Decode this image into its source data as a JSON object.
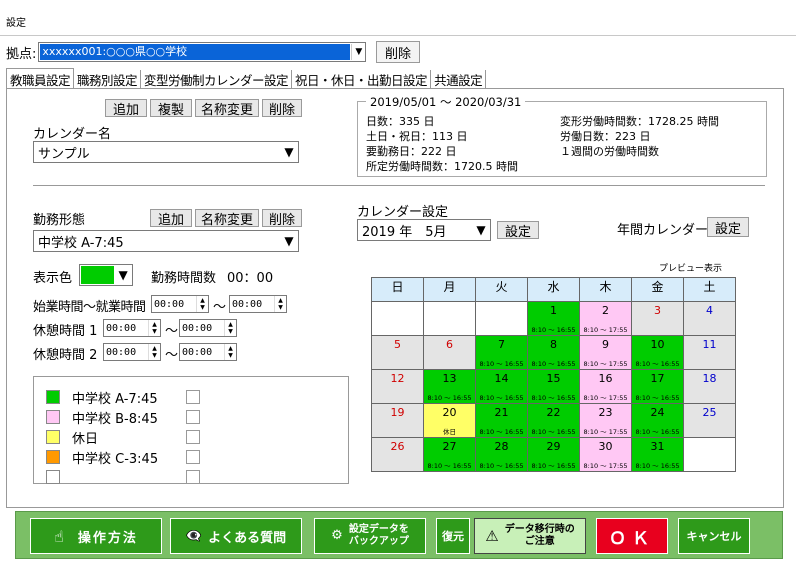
{
  "window_title": "設定",
  "site": {
    "label": "拠点:",
    "value": "xxxxxx001:○○○県○○学校",
    "delete_label": "削除"
  },
  "tabs": [
    "教職員設定",
    "職務別設定",
    "変型労働制カレンダー設定",
    "祝日・休日・出勤日設定",
    "共通設定"
  ],
  "calendar_name": {
    "buttons": [
      "追加",
      "複製",
      "名称変更",
      "削除"
    ],
    "label": "カレンダー名",
    "value": "サンプル"
  },
  "summary": {
    "period": "2019/05/01 ～ 2020/03/31",
    "days": "日数：335 日",
    "holidays": "土日・祝日：113 日",
    "required": "要勤務日：222 日",
    "scheduled": "所定労働時間数：1720.5 時間",
    "variable": "変形労働時間数：1728.25 時間",
    "workdays": "労働日数：223 日",
    "weekly": "１週間の労働時間数"
  },
  "work_type": {
    "label": "勤務形態",
    "buttons": [
      "追加",
      "名称変更",
      "削除"
    ],
    "value": "中学校 A-7:45",
    "color_label": "表示色",
    "color": "#00cc00",
    "hours_label": "勤務時間数",
    "hours": "00：00",
    "time_label": "始業時間～就業時間",
    "start": "00:00",
    "end": "00:00",
    "break1_label": "休憩時間 1",
    "b1s": "00:00",
    "b1e": "00:00",
    "break2_label": "休憩時間 2",
    "b2s": "00:00",
    "b2e": "00:00",
    "tilde": "～"
  },
  "legend": [
    {
      "name": "中学校 A-7:45",
      "color": "#00cc00"
    },
    {
      "name": "中学校 B-8:45",
      "color": "#ffc8f4"
    },
    {
      "name": "休日",
      "color": "#ffff66"
    },
    {
      "name": "中学校 C-3:45",
      "color": "#ff9900"
    },
    {
      "name": "",
      "color": "#ffffff"
    }
  ],
  "cal_setting": {
    "label": "カレンダー設定",
    "month": "2019 年　5月",
    "set": "設定",
    "annual_label": "年間カレンダー",
    "annual_set": "設定",
    "preview": "プレビュー表示"
  },
  "weekdays": [
    "日",
    "月",
    "火",
    "水",
    "木",
    "金",
    "土"
  ],
  "weeks": [
    [
      {
        "d": "",
        "c": "w"
      },
      {
        "d": "",
        "c": "w"
      },
      {
        "d": "",
        "c": "w"
      },
      {
        "d": "1",
        "c": "g",
        "t": "8:10 ～ 16:55"
      },
      {
        "d": "2",
        "c": "p",
        "t": "8:10 ～ 17:55"
      },
      {
        "d": "3",
        "c": "e"
      },
      {
        "d": "4",
        "c": "e"
      }
    ],
    [
      {
        "d": "5",
        "c": "e"
      },
      {
        "d": "6",
        "c": "e"
      },
      {
        "d": "7",
        "c": "g",
        "t": "8:10 ～ 16:55"
      },
      {
        "d": "8",
        "c": "g",
        "t": "8:10 ～ 16:55"
      },
      {
        "d": "9",
        "c": "p",
        "t": "8:10 ～ 17:55"
      },
      {
        "d": "10",
        "c": "g",
        "t": "8:10 ～ 16:55"
      },
      {
        "d": "11",
        "c": "e"
      }
    ],
    [
      {
        "d": "12",
        "c": "e"
      },
      {
        "d": "13",
        "c": "g",
        "t": "8:10 ～ 16:55"
      },
      {
        "d": "14",
        "c": "g",
        "t": "8:10 ～ 16:55"
      },
      {
        "d": "15",
        "c": "g",
        "t": "8:10 ～ 16:55"
      },
      {
        "d": "16",
        "c": "p",
        "t": "8:10 ～ 17:55"
      },
      {
        "d": "17",
        "c": "g",
        "t": "8:10 ～ 16:55"
      },
      {
        "d": "18",
        "c": "e"
      }
    ],
    [
      {
        "d": "19",
        "c": "e"
      },
      {
        "d": "20",
        "c": "y",
        "t": "休日"
      },
      {
        "d": "21",
        "c": "g",
        "t": "8:10 ～ 16:55"
      },
      {
        "d": "22",
        "c": "g",
        "t": "8:10 ～ 16:55"
      },
      {
        "d": "23",
        "c": "p",
        "t": "8:10 ～ 17:55"
      },
      {
        "d": "24",
        "c": "g",
        "t": "8:10 ～ 16:55"
      },
      {
        "d": "25",
        "c": "e"
      }
    ],
    [
      {
        "d": "26",
        "c": "e"
      },
      {
        "d": "27",
        "c": "g",
        "t": "8:10 ～ 16:55"
      },
      {
        "d": "28",
        "c": "g",
        "t": "8:10 ～ 16:55"
      },
      {
        "d": "29",
        "c": "g",
        "t": "8:10 ～ 16:55"
      },
      {
        "d": "30",
        "c": "p",
        "t": "8:10 ～ 17:55"
      },
      {
        "d": "31",
        "c": "g",
        "t": "8:10 ～ 16:55"
      },
      {
        "d": "",
        "c": "w"
      }
    ]
  ],
  "bottom": {
    "howto": "操作方法",
    "faq": "よくある質問",
    "backup1": "設定データを",
    "backup2": "バックアップ",
    "restore": "復元",
    "migrate1": "データ移行時の",
    "migrate2": "ご注意",
    "ok": "ＯＫ",
    "cancel": "キャンセル"
  }
}
